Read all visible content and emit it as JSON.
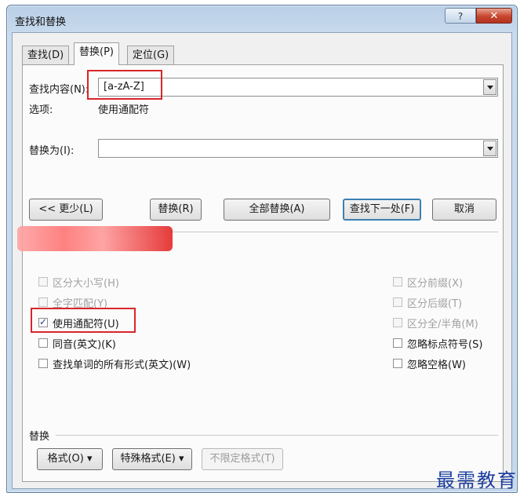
{
  "window": {
    "title": "查找和替换",
    "help_label": "?",
    "close_label": "✕"
  },
  "tabs": [
    {
      "label": "查找(D)",
      "active": false
    },
    {
      "label": "替换(P)",
      "active": true
    },
    {
      "label": "定位(G)",
      "active": false
    }
  ],
  "find": {
    "label": "查找内容(N):",
    "value": "[a-zA-Z]",
    "options_label": "选项:",
    "options_value": "使用通配符"
  },
  "replace": {
    "label": "替换为(I):",
    "value": ""
  },
  "buttons": {
    "less": "<< 更少(L)",
    "replace": "替换(R)",
    "replace_all": "全部替换(A)",
    "find_next": "查找下一处(F)",
    "cancel": "取消"
  },
  "search_options": {
    "checkboxes_left": [
      {
        "label": "区分大小写(H)",
        "checked": false,
        "enabled": false
      },
      {
        "label": "全字匹配(Y)",
        "checked": false,
        "enabled": false
      },
      {
        "label": "使用通配符(U)",
        "checked": true,
        "enabled": true
      },
      {
        "label": "同音(英文)(K)",
        "checked": false,
        "enabled": true
      },
      {
        "label": "查找单词的所有形式(英文)(W)",
        "checked": false,
        "enabled": true
      }
    ],
    "checkboxes_right": [
      {
        "label": "区分前缀(X)",
        "checked": false,
        "enabled": false
      },
      {
        "label": "区分后缀(T)",
        "checked": false,
        "enabled": false
      },
      {
        "label": "区分全/半角(M)",
        "checked": false,
        "enabled": false
      },
      {
        "label": "忽略标点符号(S)",
        "checked": false,
        "enabled": true
      },
      {
        "label": "忽略空格(W)",
        "checked": false,
        "enabled": true
      }
    ]
  },
  "replace_section": {
    "title": "替换",
    "format_button": "格式(O) ▾",
    "special_button": "特殊格式(E) ▾",
    "no_format_button": "不限定格式(T)"
  },
  "watermark": "最需教育",
  "colors": {
    "highlight_box": "#d8262b",
    "title_bar": "#c9dbee",
    "close_button": "#c8452e"
  }
}
